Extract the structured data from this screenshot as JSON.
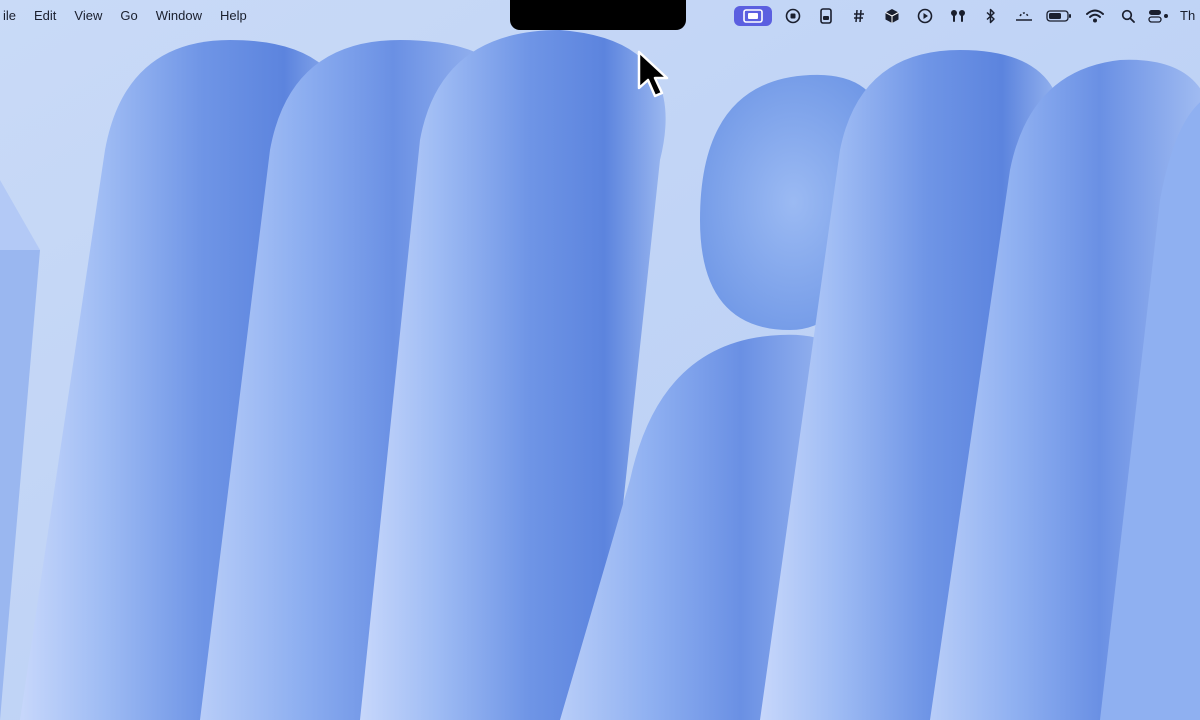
{
  "menubar": {
    "menus": [
      {
        "label": "ile",
        "name": "menu-file"
      },
      {
        "label": "Edit",
        "name": "menu-edit"
      },
      {
        "label": "View",
        "name": "menu-view"
      },
      {
        "label": "Go",
        "name": "menu-go"
      },
      {
        "label": "Window",
        "name": "menu-window"
      },
      {
        "label": "Help",
        "name": "menu-help"
      }
    ],
    "status_icons": [
      "screen-mirroring-icon",
      "stop-record-icon",
      "device-icon",
      "hashtag-icon",
      "package-icon",
      "play-icon",
      "airpods-icon",
      "bluetooth-icon",
      "weather-icon",
      "battery-icon",
      "wifi-icon",
      "spotlight-search-icon",
      "control-center-icon"
    ],
    "clock_partial": "Th",
    "accent_color": "#5b5fe0"
  },
  "desktop": {
    "wallpaper": "macOS blue abstract ribbons"
  }
}
